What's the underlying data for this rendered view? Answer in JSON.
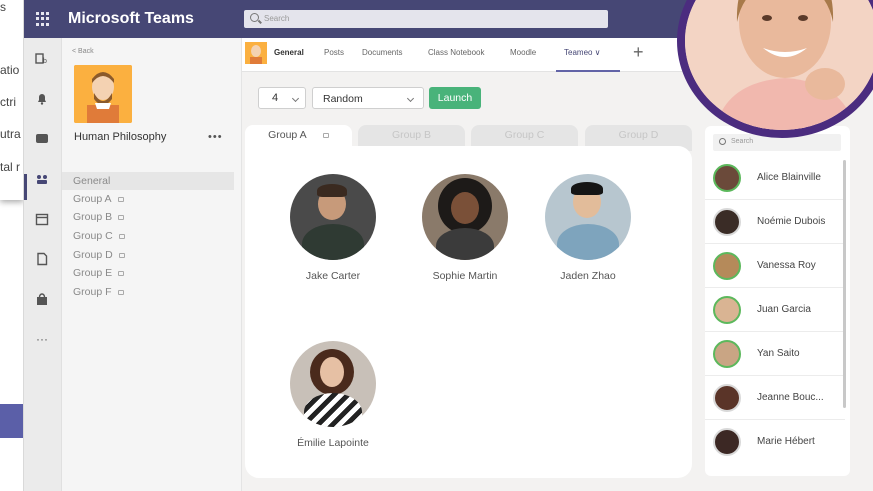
{
  "app": {
    "title": "Microsoft Teams",
    "search_placeholder": "Search"
  },
  "left_panel_fragments": [
    "s",
    "atio",
    "ctri",
    "utra",
    "tal r"
  ],
  "team": {
    "back_label": "< Back",
    "name": "Human Philosophy",
    "more": "•••"
  },
  "channels": [
    "General",
    "Group A",
    "Group B",
    "Group C",
    "Group D",
    "Group E",
    "Group F"
  ],
  "tabs": [
    "General",
    "Posts",
    "Documents",
    "Class Notebook",
    "Moodle",
    "Teameo ∨"
  ],
  "add_tab": "+",
  "toolbar": {
    "group_size": "4",
    "mode": "Random",
    "launch": "Launch"
  },
  "groups": [
    "Group A",
    "Group B",
    "Group C",
    "Group D"
  ],
  "members": [
    "Jake Carter",
    "Sophie Martin",
    "Jaden Zhao",
    "Émilie Lapointe"
  ],
  "roster": {
    "search_placeholder": "Search",
    "people": [
      "Alice Blainville",
      "Noémie Dubois",
      "Vanessa Roy",
      "Juan Garcia",
      "Yan Saito",
      "Jeanne Bouc...",
      "Marie Hébert"
    ]
  },
  "colors": {
    "brand": "#464775",
    "accent": "#6264a7",
    "launch": "#49b37a",
    "presenter_ring": "#4b2c7f"
  }
}
